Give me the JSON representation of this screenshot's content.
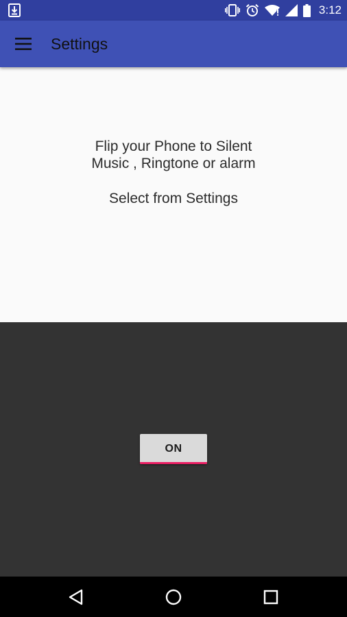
{
  "status_bar": {
    "time": "3:12",
    "icons": [
      "download-icon",
      "vibrate-icon",
      "alarm-icon",
      "wifi-icon",
      "signal-icon",
      "battery-icon"
    ]
  },
  "app_bar": {
    "title": "Settings",
    "menu_icon": "hamburger-menu-icon"
  },
  "main": {
    "line1": "Flip your Phone to Silent",
    "line2": "Music , Ringtone or alarm",
    "line3": "Select from Settings"
  },
  "toggle": {
    "label": "ON",
    "accent_color": "#E91E63"
  },
  "nav_bar": {
    "icons": [
      "back-icon",
      "home-icon",
      "recents-icon"
    ]
  },
  "colors": {
    "status_bar": "#303F9F",
    "app_bar": "#3F51B5",
    "content_bg": "#FAFAFA",
    "dark_panel": "#333333",
    "button_bg": "#DADADA"
  }
}
